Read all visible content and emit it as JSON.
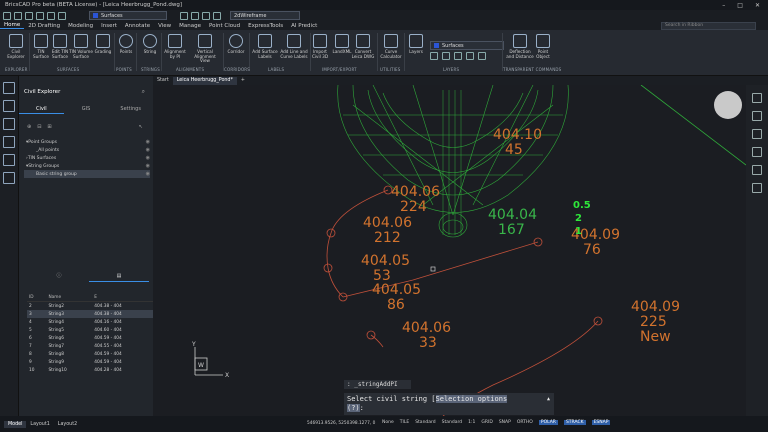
{
  "titlebar": {
    "title": "BricsCAD Pro beta (BETA License) - [Leica Heerbrugg_Pond.dwg]"
  },
  "qat": {
    "layer_combo": "Surfaces",
    "visual_style": "2dWireframe"
  },
  "menu": {
    "items": [
      "Home",
      "2D Drafting",
      "Modeling",
      "Insert",
      "Annotate",
      "View",
      "Manage",
      "Point Cloud",
      "ExpressTools",
      "AI Predict"
    ],
    "search_placeholder": "Search in Ribbon"
  },
  "ribbon": {
    "buttons": [
      {
        "label": "Civil\nExplorer"
      },
      {
        "label": "TIN\nSurface"
      },
      {
        "label": "Edit TIN\nSurface"
      },
      {
        "label": "TIN Volume\nSurface"
      },
      {
        "label": "Grading"
      },
      {
        "label": "Points"
      },
      {
        "label": "String"
      },
      {
        "label": "Alignment\nby PI"
      },
      {
        "label": "Vertical\nAlignment View"
      },
      {
        "label": "Corridor"
      },
      {
        "label": "Add Surface\nLabels"
      },
      {
        "label": "Add Line and\nCurve Labels"
      },
      {
        "label": "Import\nCivil 3D"
      },
      {
        "label": "LandXML"
      },
      {
        "label": "Convert\nLeica DWG"
      },
      {
        "label": "Curve\nCalculator"
      },
      {
        "label": "Layers"
      },
      {
        "label": "Deflection\nand Distance"
      },
      {
        "label": "Point\nObject"
      }
    ],
    "groups": [
      "EXPLORER",
      "SURFACES",
      "POINTS",
      "STRINGS",
      "ALIGNMENTS",
      "CORRIDORS",
      "LABELS",
      "IMPORT/EXPORT",
      "UTILITIES",
      "LAYERS",
      "TRANSPARENT COMMANDS"
    ],
    "layer_combo": "Surfaces"
  },
  "panel": {
    "title": "Civil Explorer",
    "tabs": [
      "Civil",
      "GIS",
      "Settings"
    ],
    "tree": [
      {
        "label": "Point Groups"
      },
      {
        "label": "_All points"
      },
      {
        "label": "TIN Surfaces"
      },
      {
        "label": "String Groups"
      },
      {
        "label": "Basic string group"
      }
    ],
    "table": {
      "headers": [
        "ID",
        "Name",
        "E"
      ],
      "rows": [
        {
          "id": "2",
          "name": "String2",
          "e": "404.38 - 404"
        },
        {
          "id": "3",
          "name": "String3",
          "e": "404.38 - 404"
        },
        {
          "id": "4",
          "name": "String4",
          "e": "404.16 - 404"
        },
        {
          "id": "5",
          "name": "String5",
          "e": "404.60 - 404"
        },
        {
          "id": "6",
          "name": "String6",
          "e": "404.59 - 404"
        },
        {
          "id": "7",
          "name": "String7",
          "e": "404.55 - 404"
        },
        {
          "id": "8",
          "name": "String8",
          "e": "404.59 - 404"
        },
        {
          "id": "9",
          "name": "String9",
          "e": "404.59 - 404"
        },
        {
          "id": "10",
          "name": "String10",
          "e": "404.28 - 404"
        }
      ]
    }
  },
  "filetabs": [
    "Start",
    "Leica Heerbrugg_Pond*"
  ],
  "canvas": {
    "labels": [
      {
        "elev": "404.10",
        "id": "45"
      },
      {
        "elev": "404.06",
        "id": "224"
      },
      {
        "elev": "404.04",
        "id": "167"
      },
      {
        "elev": "404.06",
        "id": "212"
      },
      {
        "elev": "404.09",
        "id": "76"
      },
      {
        "elev": "404.05",
        "id": "53"
      },
      {
        "elev": "404.05",
        "id": "86"
      },
      {
        "elev": "404.09",
        "id": "225"
      },
      {
        "elev": "404.06",
        "id": "33"
      }
    ],
    "new_label": "New",
    "green_values": [
      "0.5",
      "2",
      "1"
    ],
    "axes": {
      "y": "Y",
      "x": "X",
      "w": "W"
    }
  },
  "command": {
    "history": ": _stringAddPI",
    "prompt_text": "Select civil string [",
    "prompt_option": "Selection options",
    "prompt_end": "]:",
    "prompt_cursor": "(?)"
  },
  "status": {
    "tabs": [
      "Model",
      "Layout1",
      "Layout2"
    ],
    "coords": "546913.9526, 5250398.1277, 0",
    "items": [
      "None",
      "TILE",
      "Standard",
      "Standard",
      "1:1",
      "GRID",
      "SNAP",
      "ORTHO",
      "POLAR",
      "STRACK",
      "ESNAP"
    ],
    "active_items": [
      "POLAR",
      "STRACK",
      "ESNAP"
    ]
  }
}
